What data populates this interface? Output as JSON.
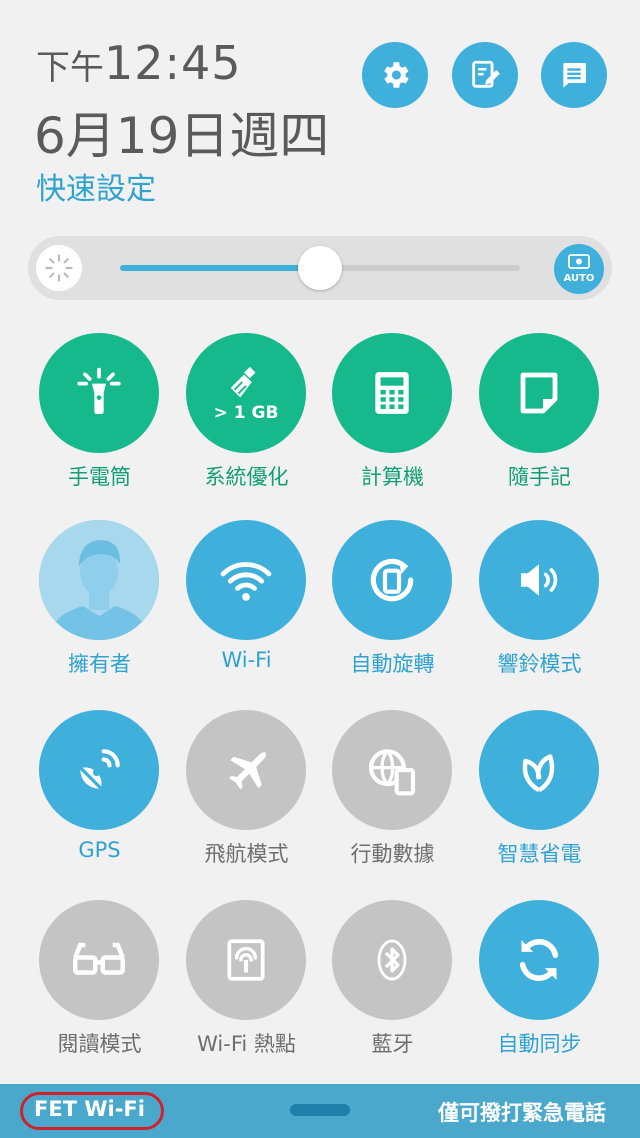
{
  "header": {
    "time_prefix": "下午",
    "time": "12:45",
    "date": "6月19日週四",
    "quick_settings_title": "快速設定",
    "buttons": [
      {
        "name": "settings-button",
        "icon": "gear-icon"
      },
      {
        "name": "edit-tiles-button",
        "icon": "edit-icon"
      },
      {
        "name": "notification-button",
        "icon": "message-icon"
      }
    ]
  },
  "brightness": {
    "level": 0.5,
    "auto_label": "AUTO"
  },
  "tiles": [
    {
      "label": "手電筒",
      "state": "active",
      "color": "#16b98b",
      "icon": "flashlight-icon"
    },
    {
      "label": "系統優化",
      "state": "active",
      "color": "#16b98b",
      "icon": "broom-icon",
      "badge": "> 1 GB"
    },
    {
      "label": "計算機",
      "state": "active",
      "color": "#16b98b",
      "icon": "calculator-icon"
    },
    {
      "label": "隨手記",
      "state": "active",
      "color": "#16b98b",
      "icon": "note-icon"
    },
    {
      "label": "擁有者",
      "state": "active",
      "color": "#3fb0db",
      "icon": "user-avatar-icon"
    },
    {
      "label": "Wi-Fi",
      "state": "active",
      "color": "#3fb0db",
      "icon": "wifi-icon"
    },
    {
      "label": "自動旋轉",
      "state": "active",
      "color": "#3fb0db",
      "icon": "rotate-icon"
    },
    {
      "label": "響鈴模式",
      "state": "active",
      "color": "#3fb0db",
      "icon": "speaker-icon"
    },
    {
      "label": "GPS",
      "state": "active",
      "color": "#3fb0db",
      "icon": "gps-icon"
    },
    {
      "label": "飛航模式",
      "state": "inactive",
      "color": "#c4c4c4",
      "icon": "airplane-icon"
    },
    {
      "label": "行動數據",
      "state": "inactive",
      "color": "#c4c4c4",
      "icon": "mobile-data-icon"
    },
    {
      "label": "智慧省電",
      "state": "active",
      "color": "#3fb0db",
      "icon": "leaf-icon"
    },
    {
      "label": "閱讀模式",
      "state": "inactive",
      "color": "#c4c4c4",
      "icon": "glasses-icon"
    },
    {
      "label": "Wi-Fi 熱點",
      "state": "inactive",
      "color": "#c4c4c4",
      "icon": "hotspot-icon"
    },
    {
      "label": "藍牙",
      "state": "inactive",
      "color": "#c4c4c4",
      "icon": "bluetooth-icon"
    },
    {
      "label": "自動同步",
      "state": "active",
      "color": "#3fb0db",
      "icon": "sync-icon"
    }
  ],
  "bottom_bar": {
    "carrier": "FET Wi-Fi",
    "emergency_text": "僅可撥打緊急電話"
  }
}
